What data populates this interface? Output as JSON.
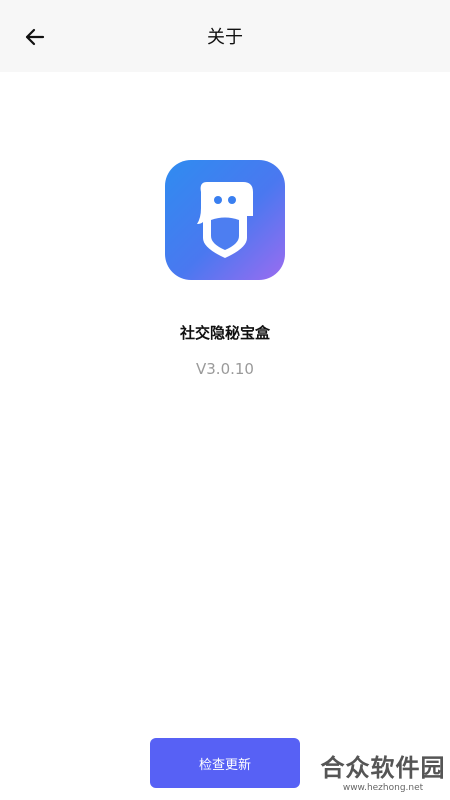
{
  "header": {
    "title": "关于",
    "back_icon": "arrow-left-icon"
  },
  "app": {
    "icon": "app-logo-icon",
    "name": "社交隐秘宝盒",
    "version": "V3.0.10"
  },
  "actions": {
    "check_update_label": "检查更新"
  },
  "watermark": {
    "name": "合众软件园",
    "url": "www.hezhong.net"
  },
  "colors": {
    "header_bg": "#f7f7f7",
    "accent": "#5761f5",
    "icon_gradient_start": "#4e7ff2",
    "icon_gradient_end": "#9b6cf0",
    "version_text": "#9a9a9a"
  }
}
